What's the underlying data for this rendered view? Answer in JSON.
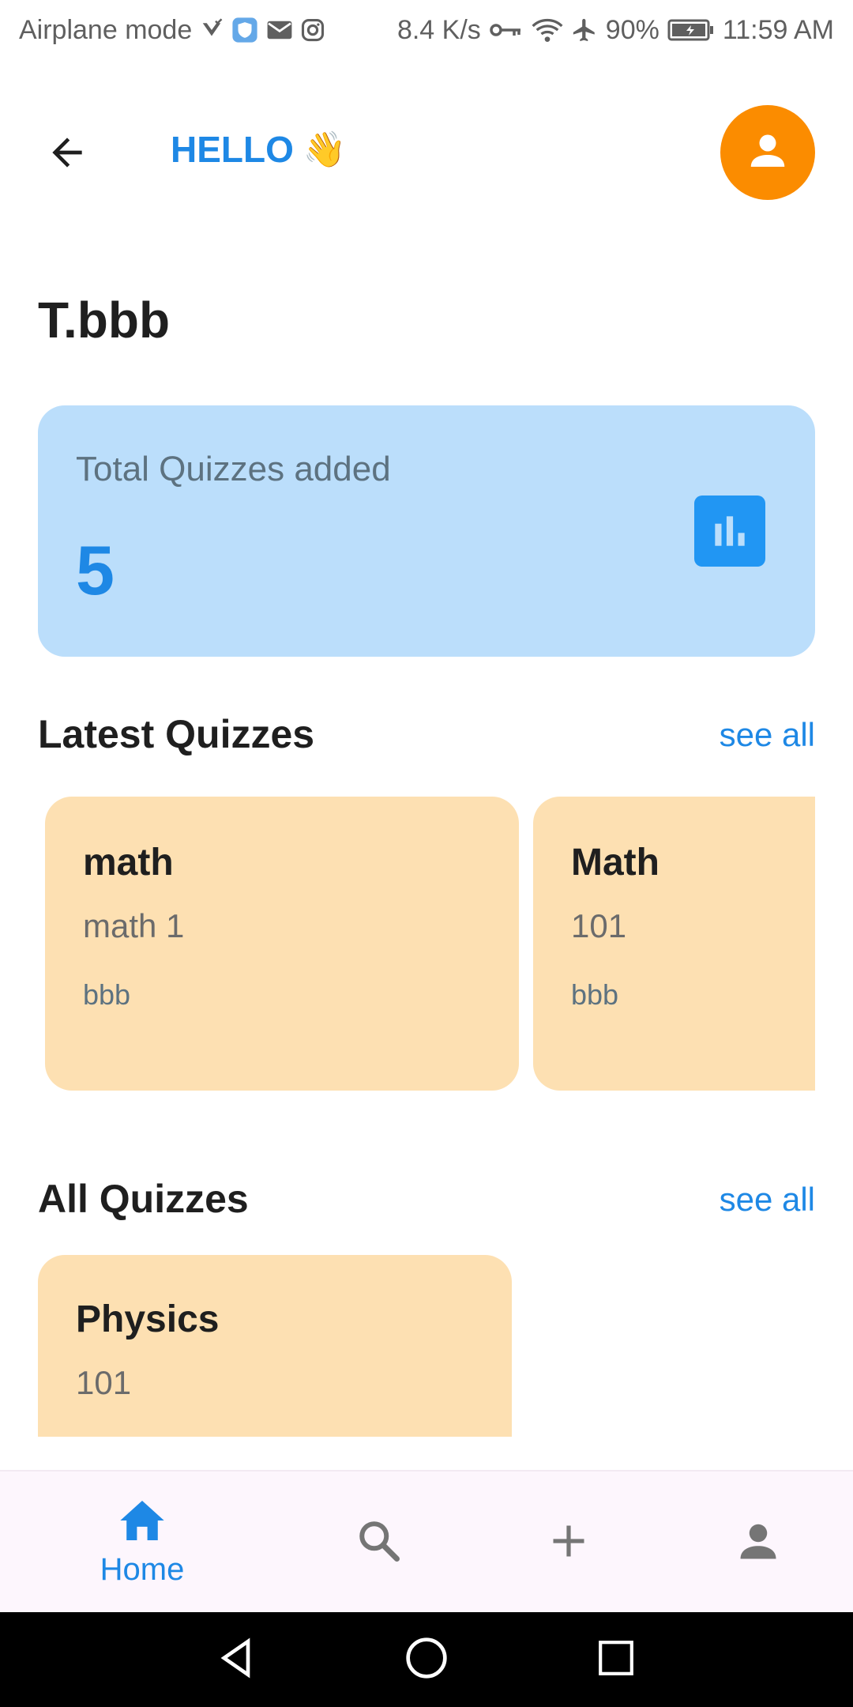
{
  "status_bar": {
    "left_text": "Airplane mode",
    "speed": "8.4 K/s",
    "battery": "90%",
    "time": "11:59 AM"
  },
  "header": {
    "greeting": "HELLO",
    "wave_emoji": "👋",
    "back_icon": "arrow-back-icon",
    "avatar_icon": "person-icon",
    "avatar_color": "#fb8c00"
  },
  "user": {
    "name": "T.bbb"
  },
  "stats": {
    "label": "Total Quizzes added",
    "value": "5",
    "icon": "bar-chart-icon",
    "card_color": "#bbdefb",
    "accent": "#1e88e5"
  },
  "latest": {
    "title": "Latest Quizzes",
    "see_all": "see all",
    "items": [
      {
        "title": "math",
        "subtitle": "math 1",
        "author": "bbb"
      },
      {
        "title": "Math",
        "subtitle": "101",
        "author": "bbb"
      }
    ]
  },
  "all_quizzes": {
    "title": "All Quizzes",
    "see_all": "see all",
    "items": [
      {
        "title": "Physics",
        "subtitle": "101"
      }
    ]
  },
  "bottom_nav": {
    "items": [
      {
        "label": "Home",
        "icon": "home-icon",
        "active": true
      },
      {
        "label": "",
        "icon": "search-icon",
        "active": false
      },
      {
        "label": "",
        "icon": "add-icon",
        "active": false
      },
      {
        "label": "",
        "icon": "person-icon",
        "active": false
      }
    ]
  },
  "colors": {
    "card_orange": "#fde0b2",
    "primary": "#1e88e5"
  }
}
